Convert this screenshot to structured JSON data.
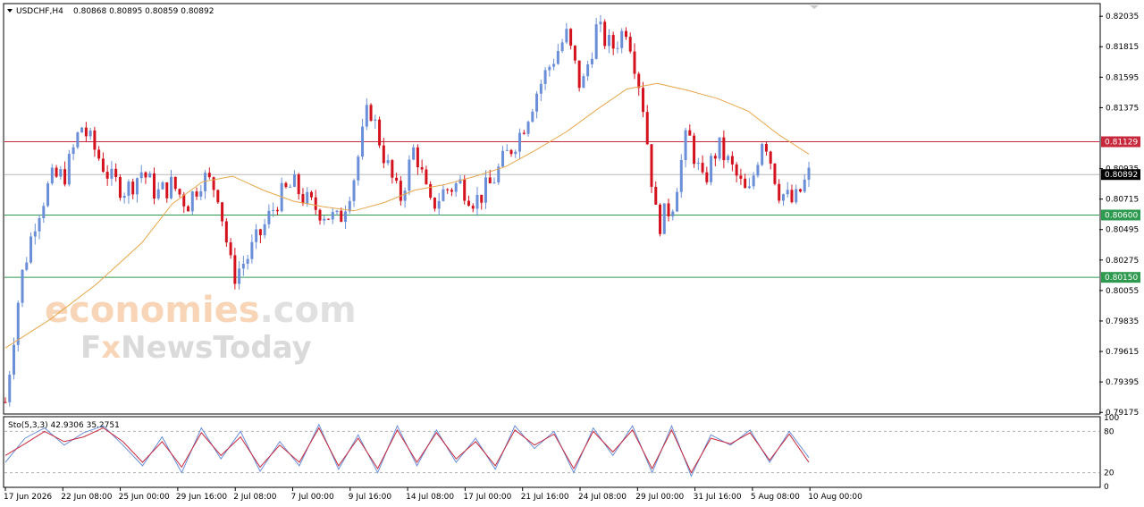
{
  "header": {
    "symbol": "USDCHF,H4",
    "ohlc": "0.80868 0.80895 0.80859 0.80892"
  },
  "watermark": {
    "line1a": "economies",
    "line1b": ".com",
    "line2a": "F",
    "line2b": "x",
    "line2c": "NewsToday"
  },
  "indicator": {
    "label": "Sto(5,3,3) 42.9306 35.2751",
    "levels": [
      "100",
      "80",
      "20",
      "0"
    ]
  },
  "colors": {
    "bull": "#6a8fd8",
    "bear": "#d4121e",
    "ma": "#e8a64a",
    "resistance": "#c8283c",
    "support": "#2d9a4f",
    "current": "#000000",
    "stoch_main": "#6a8fd8",
    "stoch_signal": "#c8283c"
  },
  "chart_data": {
    "type": "candlestick",
    "symbol": "USDCHF",
    "timeframe": "H4",
    "ylim": [
      0.7917,
      0.8212
    ],
    "y_ticks": [
      "0.82035",
      "0.81815",
      "0.81595",
      "0.81375",
      "0.80935",
      "0.80715",
      "0.80495",
      "0.80275",
      "0.80055",
      "0.79835",
      "0.79615",
      "0.79395",
      "0.79175"
    ],
    "x_ticks": [
      "17 Jun 2026",
      "22 Jun 08:00",
      "25 Jun 00:00",
      "29 Jun 16:00",
      "2 Jul 08:00",
      "7 Jul 00:00",
      "9 Jul 16:00",
      "14 Jul 08:00",
      "17 Jul 00:00",
      "21 Jul 16:00",
      "24 Jul 08:00",
      "29 Jul 00:00",
      "31 Jul 16:00",
      "5 Aug 08:00",
      "10 Aug 00:00"
    ],
    "price_levels": [
      {
        "label": "0.81129",
        "value": 0.81129,
        "role": "resistance"
      },
      {
        "label": "0.80892",
        "value": 0.80892,
        "role": "current"
      },
      {
        "label": "0.80600",
        "value": 0.806,
        "role": "support"
      },
      {
        "label": "0.80150",
        "value": 0.8015,
        "role": "support"
      }
    ],
    "close_path": [
      [
        0,
        0.7925
      ],
      [
        1,
        0.8012
      ],
      [
        2,
        0.8058
      ],
      [
        3,
        0.8085
      ],
      [
        4,
        0.809
      ],
      [
        5,
        0.8125
      ],
      [
        6,
        0.8105
      ],
      [
        7,
        0.8085
      ],
      [
        8,
        0.8078
      ],
      [
        9,
        0.8092
      ],
      [
        10,
        0.8075
      ],
      [
        11,
        0.8082
      ],
      [
        12,
        0.8068
      ],
      [
        13,
        0.8088
      ],
      [
        14,
        0.8078
      ],
      [
        15,
        0.8015
      ],
      [
        16,
        0.803
      ],
      [
        17,
        0.805
      ],
      [
        18,
        0.8072
      ],
      [
        19,
        0.8082
      ],
      [
        20,
        0.8068
      ],
      [
        21,
        0.8062
      ],
      [
        22,
        0.8055
      ],
      [
        23,
        0.8088
      ],
      [
        24,
        0.814
      ],
      [
        25,
        0.8102
      ],
      [
        26,
        0.807
      ],
      [
        27,
        0.811
      ],
      [
        28,
        0.8065
      ],
      [
        29,
        0.8078
      ],
      [
        30,
        0.8083
      ],
      [
        31,
        0.807
      ],
      [
        32,
        0.8082
      ],
      [
        33,
        0.8102
      ],
      [
        34,
        0.812
      ],
      [
        35,
        0.8148
      ],
      [
        36,
        0.817
      ],
      [
        37,
        0.819
      ],
      [
        38,
        0.815
      ],
      [
        39,
        0.8195
      ],
      [
        40,
        0.818
      ],
      [
        41,
        0.8197
      ],
      [
        42,
        0.8145
      ],
      [
        43,
        0.8052
      ],
      [
        44,
        0.8068
      ],
      [
        45,
        0.812
      ],
      [
        46,
        0.8082
      ],
      [
        47,
        0.811
      ],
      [
        48,
        0.8092
      ],
      [
        49,
        0.8072
      ],
      [
        50,
        0.812
      ],
      [
        51,
        0.8078
      ],
      [
        52,
        0.8068
      ],
      [
        53,
        0.8089
      ]
    ],
    "moving_average": [
      [
        0,
        0.7964
      ],
      [
        3,
        0.7985
      ],
      [
        6,
        0.801
      ],
      [
        9,
        0.804
      ],
      [
        11,
        0.8068
      ],
      [
        13,
        0.8084
      ],
      [
        15,
        0.8088
      ],
      [
        17,
        0.8078
      ],
      [
        19,
        0.807
      ],
      [
        21,
        0.8066
      ],
      [
        23,
        0.8063
      ],
      [
        25,
        0.8069
      ],
      [
        27,
        0.8078
      ],
      [
        29,
        0.8082
      ],
      [
        31,
        0.8088
      ],
      [
        33,
        0.8095
      ],
      [
        35,
        0.8107
      ],
      [
        37,
        0.812
      ],
      [
        39,
        0.8136
      ],
      [
        41,
        0.8151
      ],
      [
        43,
        0.8155
      ],
      [
        45,
        0.815
      ],
      [
        47,
        0.8144
      ],
      [
        49,
        0.8135
      ],
      [
        51,
        0.8118
      ],
      [
        53,
        0.8104
      ]
    ],
    "stochastic": {
      "name": "Sto(5,3,3)",
      "main_last": 42.9306,
      "signal_last": 35.2751,
      "levels": [
        20,
        80
      ],
      "main": [
        35,
        70,
        85,
        60,
        78,
        88,
        60,
        30,
        72,
        20,
        85,
        40,
        80,
        22,
        65,
        30,
        90,
        25,
        75,
        20,
        88,
        30,
        82,
        35,
        70,
        25,
        88,
        55,
        80,
        20,
        85,
        45,
        88,
        20,
        88,
        15,
        75,
        60,
        82,
        35,
        80,
        42
      ],
      "signal": [
        45,
        62,
        80,
        65,
        72,
        85,
        65,
        35,
        65,
        28,
        78,
        45,
        72,
        28,
        60,
        35,
        85,
        30,
        70,
        26,
        82,
        35,
        78,
        40,
        65,
        30,
        82,
        60,
        76,
        26,
        80,
        50,
        82,
        26,
        82,
        20,
        70,
        62,
        78,
        38,
        76,
        35
      ]
    }
  }
}
